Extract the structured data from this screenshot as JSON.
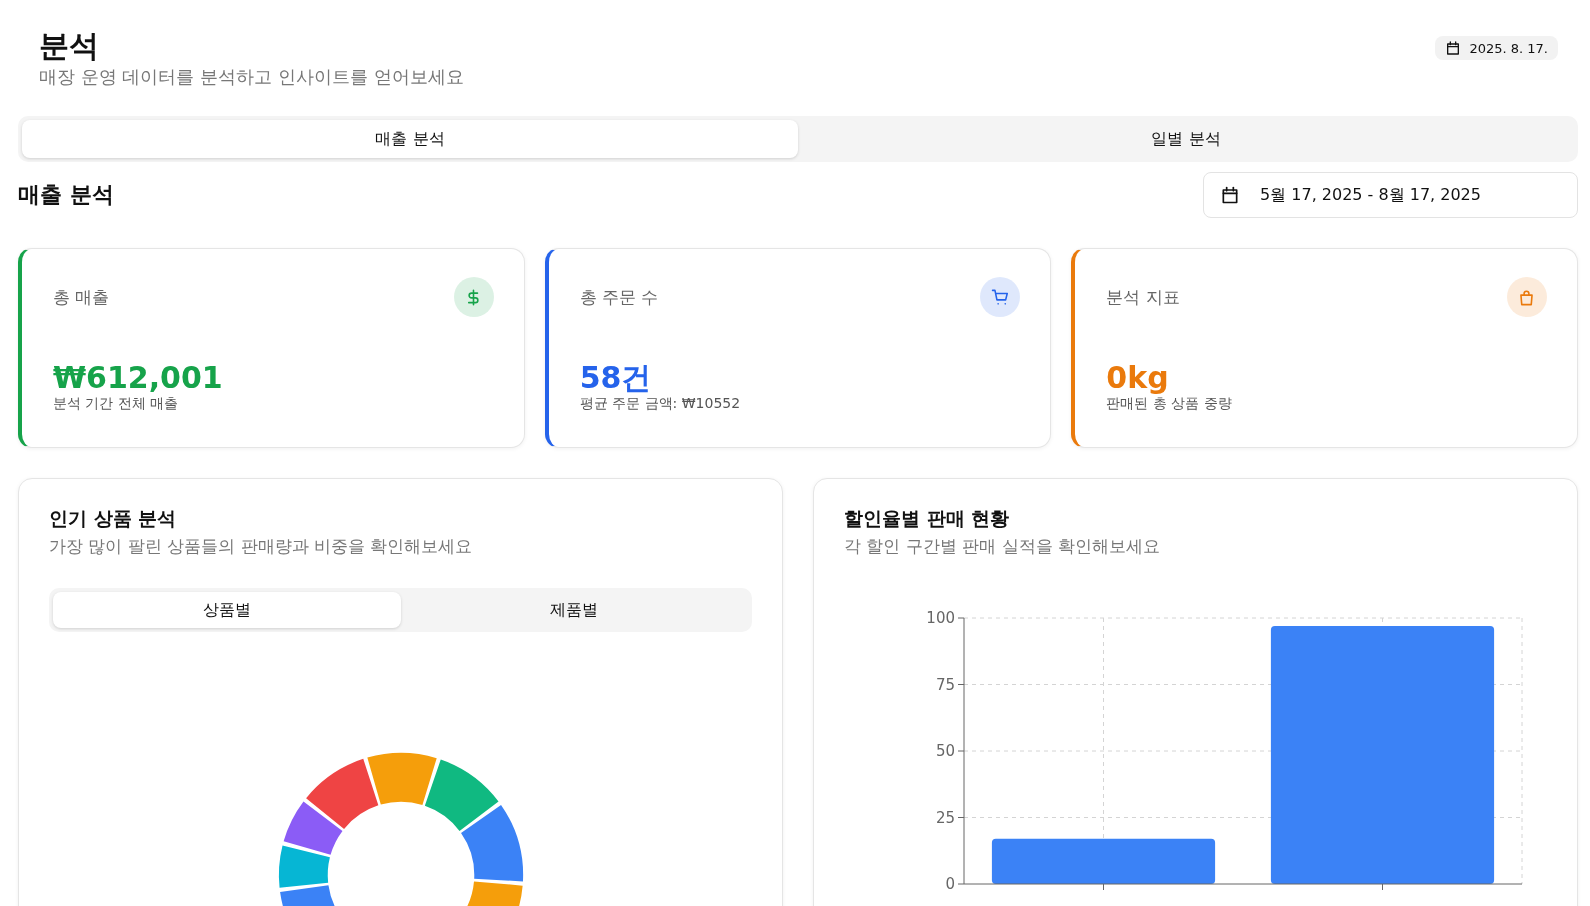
{
  "header": {
    "title": "분석",
    "subtitle": "매장 운영 데이터를 분석하고 인사이트를 얻어보세요",
    "date_badge": "2025. 8. 17."
  },
  "tabs": [
    {
      "label": "매출 분석",
      "selected": true
    },
    {
      "label": "일별 분석",
      "selected": false
    }
  ],
  "section": {
    "title": "매출 분석",
    "date_range": "5월 17, 2025 - 8월 17, 2025"
  },
  "stat_cards": [
    {
      "kind": "dollar",
      "label": "총 매출",
      "value": "₩612,001",
      "caption": "분석 기간 전체 매출",
      "color": "#16a34a"
    },
    {
      "kind": "cart",
      "label": "총 주문 수",
      "value": "58건",
      "caption": "평균 주문 금액: ₩10552",
      "color": "#2563eb"
    },
    {
      "kind": "bag",
      "label": "분석 지표",
      "value": "0kg",
      "caption": "판매된 총 상품 중량",
      "color": "#ea7a0c"
    }
  ],
  "popular_panel": {
    "title": "인기 상품 분석",
    "subtitle": "가장 많이 팔린 상품들의 판매량과 비중을 확인해보세요",
    "subtabs": [
      {
        "label": "상품별",
        "selected": true
      },
      {
        "label": "제품별",
        "selected": false
      }
    ]
  },
  "discount_panel": {
    "title": "할인율별 판매 현황",
    "subtitle": "각 할인 구간별 판매 실적을 확인해보세요",
    "chart_data": {
      "type": "bar",
      "grid": true,
      "ylim": [
        0,
        100
      ],
      "yticks": [
        0,
        25,
        50,
        75,
        100
      ],
      "series": [
        {
          "color": "#3b82f6",
          "values": [
            17,
            97
          ]
        }
      ]
    }
  }
}
